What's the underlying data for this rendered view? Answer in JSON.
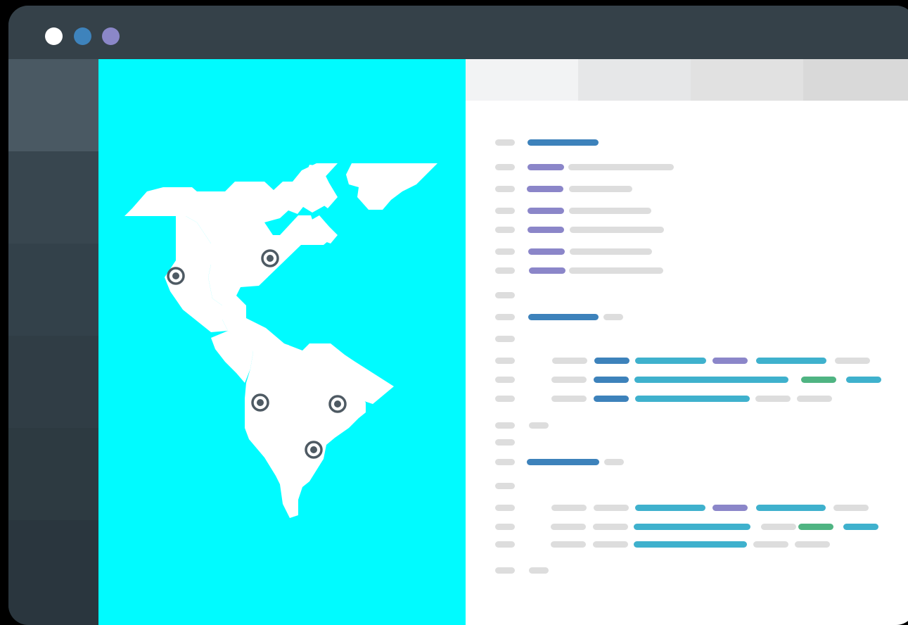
{
  "window": {
    "controls": [
      {
        "name": "close-button",
        "color": "#ffffff"
      },
      {
        "name": "minimize-button",
        "color": "#3e83bc"
      },
      {
        "name": "maximize-button",
        "color": "#8b87c8"
      }
    ],
    "titlebar_color": "#354149"
  },
  "sidebar": {
    "items": [
      {
        "color": "#4a5963",
        "active": true
      },
      {
        "color": "#38464f"
      },
      {
        "color": "#33414a"
      },
      {
        "color": "#303d45"
      },
      {
        "color": "#2d3a41"
      },
      {
        "color": "#2a363e"
      }
    ]
  },
  "map": {
    "background": "#00fbff",
    "land_color": "#ffffff",
    "marker_color": "#4e5a63",
    "markers": [
      {
        "region": "north-america-west"
      },
      {
        "region": "north-america-east"
      },
      {
        "region": "south-america-north"
      },
      {
        "region": "south-america-east"
      },
      {
        "region": "south-america-south"
      }
    ]
  },
  "editor": {
    "tabs": [
      {
        "color": "#f2f3f4"
      },
      {
        "color": "#e6e7e8"
      },
      {
        "color": "#e1e1e1"
      },
      {
        "color": "#d9d9d9"
      }
    ],
    "token_colors": {
      "gray": "#dddddd",
      "blue": "#3d82bb",
      "purple": "#8b86c9",
      "cyan": "#3fb1cd",
      "green": "#4fb482"
    }
  }
}
